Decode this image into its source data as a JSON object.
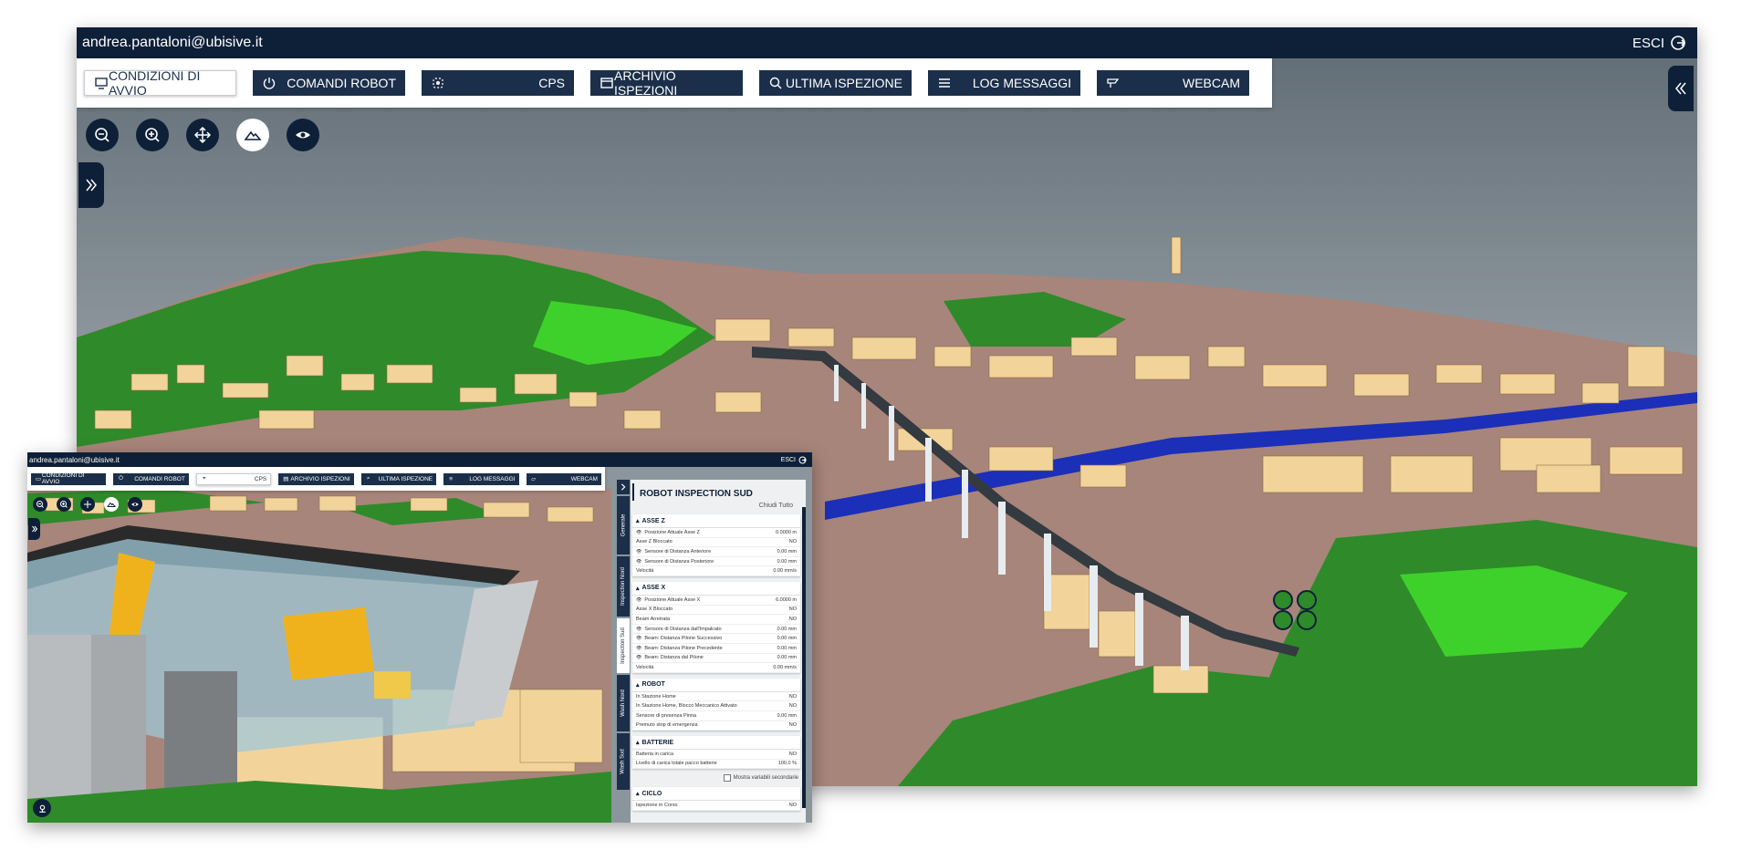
{
  "main_window": {
    "user_email": "andrea.pantaloni@ubisive.it",
    "logout_label": "ESCI",
    "toolbar": [
      {
        "label": "CONDIZIONI DI AVVIO",
        "icon": "monitor-icon",
        "active": true
      },
      {
        "label": "COMANDI ROBOT",
        "icon": "power-icon",
        "active": false
      },
      {
        "label": "CPS",
        "icon": "crosshair-icon",
        "active": false
      },
      {
        "label": "ARCHIVIO ISPEZIONI",
        "icon": "archive-icon",
        "active": false
      },
      {
        "label": "ULTIMA ISPEZIONE",
        "icon": "search-icon",
        "active": false
      },
      {
        "label": "LOG MESSAGGI",
        "icon": "list-icon",
        "active": false
      },
      {
        "label": "WEBCAM",
        "icon": "webcam-icon",
        "active": false
      }
    ],
    "round_tools": [
      "zoom-out-icon",
      "zoom-in-icon",
      "move-icon",
      "terrain-icon",
      "eye-icon"
    ]
  },
  "inset_window": {
    "user_email": "andrea.pantaloni@ubisive.it",
    "logout_label": "ESCI",
    "toolbar": [
      {
        "label": "CONDIZIONI DI AVVIO",
        "active": false
      },
      {
        "label": "COMANDI ROBOT",
        "active": false
      },
      {
        "label": "CPS",
        "active": true
      },
      {
        "label": "ARCHIVIO ISPEZIONI",
        "active": false
      },
      {
        "label": "ULTIMA ISPEZIONE",
        "active": false
      },
      {
        "label": "LOG MESSAGGI",
        "active": false
      },
      {
        "label": "WEBCAM",
        "active": false
      }
    ],
    "vertical_tabs": [
      {
        "label": "Generale",
        "active": false
      },
      {
        "label": "Inspection Nord",
        "active": false
      },
      {
        "label": "Inspection Sud",
        "active": true
      },
      {
        "label": "Wash Nord",
        "active": false
      },
      {
        "label": "Wash Sud",
        "active": false
      }
    ],
    "panel": {
      "title": "ROBOT INSPECTION SUD",
      "close_all": "Chiudi Tutto",
      "sections": [
        {
          "title": "ASSE Z",
          "rows": [
            {
              "label": "Posizione Attuale Asse Z",
              "value": "0.0000 m",
              "eye": true
            },
            {
              "label": "Asse Z Bloccato",
              "value": "NO",
              "eye": false
            },
            {
              "label": "Sensore di Distanza Anteriore",
              "value": "0.00 mm",
              "eye": true
            },
            {
              "label": "Sensore di Distanza Posteriore",
              "value": "0.00 mm",
              "eye": true
            },
            {
              "label": "Velocità",
              "value": "0.00 mm/s",
              "eye": false
            }
          ]
        },
        {
          "title": "ASSE X",
          "rows": [
            {
              "label": "Posizione Attuale Asse X",
              "value": "6.0000 m",
              "eye": true
            },
            {
              "label": "Asse X Bloccato",
              "value": "NO",
              "eye": false
            },
            {
              "label": "Beam Arretrata",
              "value": "NO",
              "eye": false
            },
            {
              "label": "Sensore di Distanza dall'Impalcato",
              "value": "0.00 mm",
              "eye": true
            },
            {
              "label": "Beam: Distanza Pilone Successivo",
              "value": "0.00 mm",
              "eye": true
            },
            {
              "label": "Beam: Distanza Pilone Precedente",
              "value": "0.00 mm",
              "eye": true
            },
            {
              "label": "Beam: Distanza dal Pilone",
              "value": "0.00 mm",
              "eye": true
            },
            {
              "label": "Velocità",
              "value": "0.00 mm/s",
              "eye": false
            }
          ]
        },
        {
          "title": "ROBOT",
          "rows": [
            {
              "label": "In Stazione Home",
              "value": "NO",
              "eye": false
            },
            {
              "label": "In Stazione Home, Blocco Meccanico Attivato",
              "value": "NO",
              "eye": false
            },
            {
              "label": "Sensore di presenza Pinna",
              "value": "0.00 mm",
              "eye": false
            },
            {
              "label": "Premuto stop di emergenza",
              "value": "NO",
              "eye": false
            }
          ]
        },
        {
          "title": "BATTERIE",
          "rows": [
            {
              "label": "Batteria in carica",
              "value": "NO",
              "eye": false
            },
            {
              "label": "Livello di carica totale pacco batterie",
              "value": "100.0 %",
              "eye": false
            }
          ]
        },
        {
          "title": "CICLO",
          "rows": [
            {
              "label": "Ispezione in Corso",
              "value": "NO",
              "eye": false
            }
          ]
        }
      ],
      "secondary_vars_label": "Mostra variabili secondarie"
    }
  },
  "colors": {
    "navy": "#0e2038",
    "button": "#1b2f4a",
    "terrain_green": "#2f8a2a",
    "building": "#f2d49a",
    "ground": "#a7857a",
    "river": "#1b2fb8"
  }
}
